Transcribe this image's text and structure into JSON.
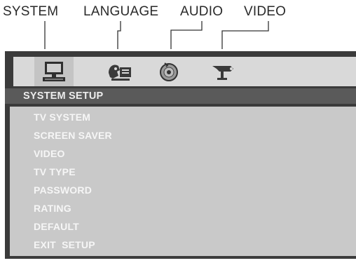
{
  "top_labels": {
    "system": "SYSTEM",
    "language": "LANGUAGE",
    "audio": "AUDIO",
    "video": "VIDEO"
  },
  "icons": [
    {
      "name": "monitor-icon",
      "selected": true
    },
    {
      "name": "language-speaker-icon",
      "selected": false
    },
    {
      "name": "disc-icon",
      "selected": false
    },
    {
      "name": "camera-icon",
      "selected": false
    }
  ],
  "section": {
    "title": "SYSTEM SETUP"
  },
  "menu": {
    "items": [
      "TV SYSTEM",
      "SCREEN SAVER",
      "VIDEO",
      "TV TYPE",
      "PASSWORD",
      "RATING",
      "DEFAULT",
      "EXIT  SETUP"
    ]
  },
  "colors": {
    "panel_bg": "#3b3b3b",
    "icon_bar_bg": "#d9d9d9",
    "title_bar_bg": "#5a5a5a",
    "menu_bg": "#c9c9c9",
    "menu_text": "#f6f6f6"
  }
}
